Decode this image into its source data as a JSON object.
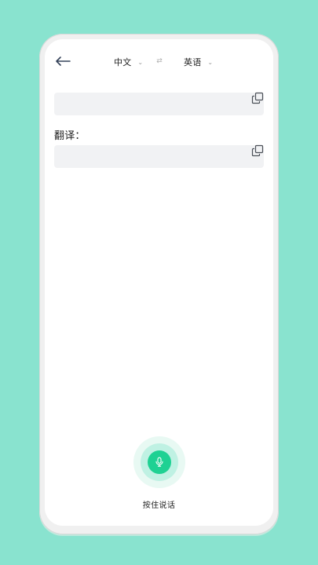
{
  "colors": {
    "background": "#89e3cf",
    "screen": "#ffffff",
    "field": "#f1f2f4",
    "accent": "#1ed193",
    "accent_ring": "#bff1e3",
    "accent_ring_light": "#e8f9f3"
  },
  "header": {
    "back_icon": "back-arrow-icon",
    "source_language": "中文",
    "target_language": "英语",
    "dropdown_icon": "chevron-down-icon",
    "swap_icon": "swap-icon",
    "swap_glyph": "⇄"
  },
  "input": {
    "value": "",
    "copy_icon": "copy-icon"
  },
  "translation": {
    "label": "翻译：",
    "value": "",
    "copy_icon": "copy-icon"
  },
  "voice": {
    "button_icon": "microphone-icon",
    "hold_to_talk_label": "按住说话"
  }
}
